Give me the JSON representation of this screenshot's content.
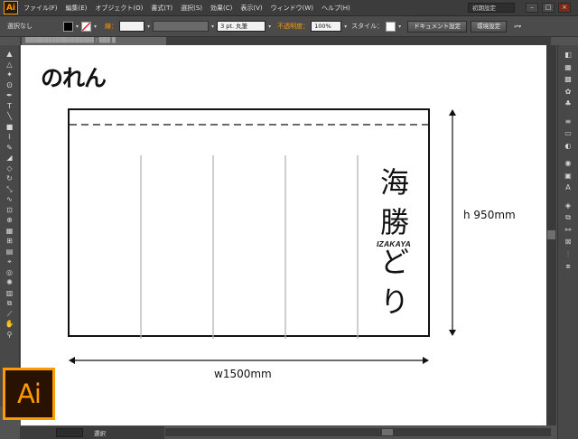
{
  "app": {
    "logo_text": "Ai",
    "menu": [
      "ファイル(F)",
      "編集(E)",
      "オブジェクト(O)",
      "書式(T)",
      "選択(S)",
      "効果(C)",
      "表示(V)",
      "ウィンドウ(W)",
      "ヘルプ(H)"
    ],
    "workspace": "初期設定",
    "window_buttons": [
      "–",
      "□",
      "×"
    ]
  },
  "control_bar": {
    "selection": "選択なし",
    "stroke_label": "線：",
    "brush": "3 pt. 丸筆",
    "opacity_label": "不透明度：",
    "opacity_value": "100%",
    "style_label": "スタイル：",
    "doc_setup_button": "ドキュメント設定",
    "prefs_button": "環境設定"
  },
  "document": {
    "tab_text": "▒▒▒▒▒▒▒▒▒▒▒▒▒▒▒▒▒▒ / ▒▒▒ ▒",
    "title": "のれん",
    "kanji": [
      "海",
      "勝",
      "ど",
      "り"
    ],
    "sub_label": "IZAKAYA",
    "height_label": "h 950mm",
    "width_label": "w1500mm"
  },
  "status": {
    "zoom": "",
    "mode": "選択"
  },
  "logo": {
    "text": "Ai",
    "color": "#ff9a00",
    "bg": "#2a1203"
  }
}
